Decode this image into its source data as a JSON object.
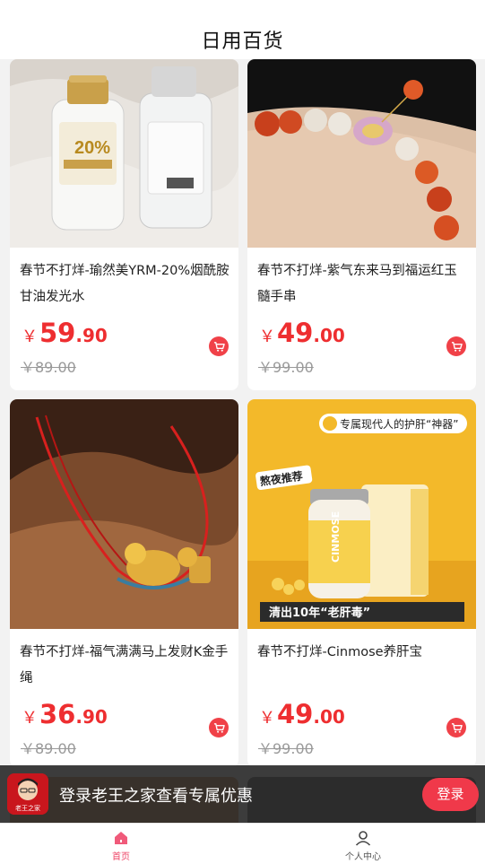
{
  "header": {
    "title": "日用百货"
  },
  "currency_symbol": "￥",
  "products": [
    {
      "name": "春节不打烊-瑜然美YRM-20%烟酰胺甘油发光水",
      "price_int": "59",
      "price_dec": ".90",
      "original_price": "￥89.00",
      "image_icon": "serum-bottles-photo"
    },
    {
      "name": "春节不打烊-紫气东来马到福运红玉髓手串",
      "price_int": "49",
      "price_dec": ".00",
      "original_price": "￥99.00",
      "image_icon": "bracelet-photo"
    },
    {
      "name": "春节不打烊-福气满满马上发财K金手绳",
      "price_int": "36",
      "price_dec": ".90",
      "original_price": "￥89.00",
      "image_icon": "red-string-gold-horse-photo"
    },
    {
      "name": "春节不打烊-Cinmose养肝宝",
      "price_int": "49",
      "price_dec": ".00",
      "original_price": "￥99.00",
      "image_icon": "supplement-bottle-photo",
      "image_texts": {
        "banner": "专属现代人的护肝“神器”",
        "tag": "熬夜推荐",
        "brand": "CINMOSE",
        "bottom": "清出10年“老肝毒”"
      }
    }
  ],
  "login_bar": {
    "text": "登录老王之家查看专属优惠",
    "button_label": "登录",
    "logo_text": "老王之家"
  },
  "tabbar": {
    "home_label": "首页",
    "profile_label": "个人中心"
  },
  "colors": {
    "accent": "#ee2e30",
    "tab_active": "#ee4466",
    "login_button": "#f0394a"
  }
}
